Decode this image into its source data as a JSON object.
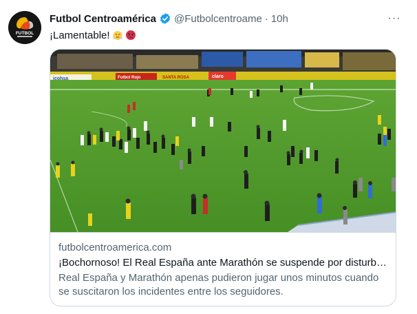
{
  "tweet": {
    "author_name": "Futbol Centroamérica",
    "handle": "@Futbolcentroame",
    "separator": "·",
    "time": "10h",
    "text": "¡Lamentable!",
    "emojis": [
      "face-with-steam-icon",
      "pouting-face-icon"
    ],
    "more_label": "···",
    "avatar_logo_text": "FUTBOL"
  },
  "card": {
    "domain": "futbolcentroamerica.com",
    "title": "¡Bochornoso! El Real España ante Marathón se suspende por disturbi…",
    "description": "Real España y Marathón apenas pudieron jugar unos minutos cuando se suscitaron los incidentes entre los seguidores.",
    "image_alt": "Stadium pitch with people on the field",
    "ad_boards": [
      "icohsa",
      "Futbol Rojo",
      "SANTA ROSA",
      "claro"
    ]
  },
  "colors": {
    "accent": "#1d9bf0",
    "text": "#0f1419",
    "muted": "#536471",
    "border": "#cfd9de",
    "pitch": "#4f9a2c"
  }
}
